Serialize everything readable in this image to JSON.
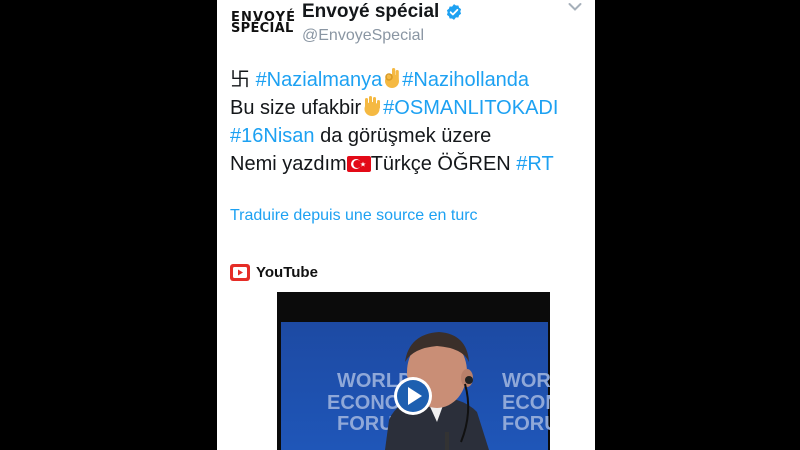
{
  "account": {
    "logo_line1": "ENVOYÉ",
    "logo_line2": "SPÉCIAL",
    "name": "Envoyé spécial",
    "handle": "@EnvoyeSpecial"
  },
  "tweet": {
    "line1": {
      "symbol": "卐",
      "tag1": "#Nazialmanya",
      "tag2": "#Nazihollanda"
    },
    "line2": {
      "text": "Bu size ufakbir",
      "tag": "#OSMANLITOKADI"
    },
    "line3": {
      "tag": "#16Nisan",
      "text": " da görüşmek üzere"
    },
    "line4": {
      "text1": "Nemi yazdım",
      "text2": "Türkçe ÖĞREN ",
      "tag": "#RT"
    }
  },
  "translate_link": "Traduire depuis une source en turc",
  "media": {
    "source_label": "YouTube",
    "video_caption_lines": [
      "WORLD",
      "ECONOMIC",
      "FORUM"
    ]
  },
  "colors": {
    "link": "#1da1f2",
    "text": "#14171a",
    "muted": "#8a96a3",
    "youtube_red": "#e52d27"
  }
}
